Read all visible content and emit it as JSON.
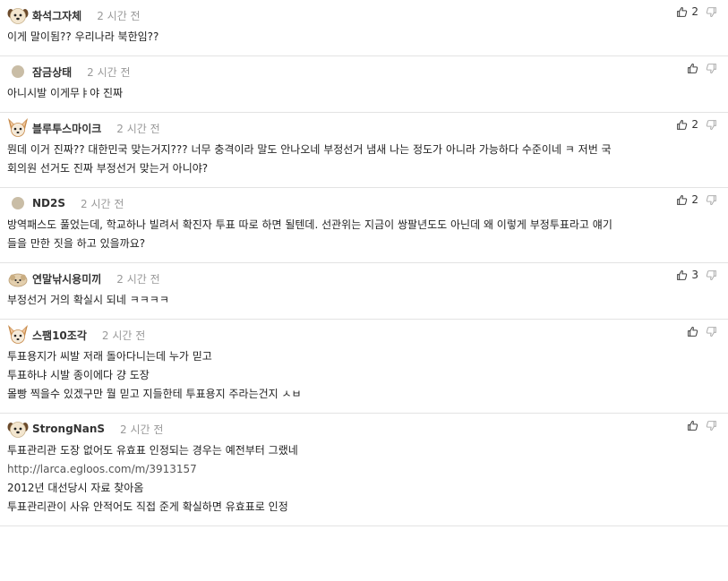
{
  "comments": [
    {
      "nick": "화석그자체",
      "time": "2 시간 전",
      "avatar": "dog-face",
      "likes": "2",
      "lines": [
        "이게 말이됨?? 우리나라 북한임??"
      ]
    },
    {
      "nick": "잠금상태",
      "time": "2 시간 전",
      "avatar": "dot",
      "likes": "",
      "lines": [
        "아니시발 이게무ㅑ야 진짜"
      ]
    },
    {
      "nick": "블루투스마이크",
      "time": "2 시간 전",
      "avatar": "chihuahua",
      "likes": "2",
      "lines": [
        "뭔데 이거 진짜?? 대한민국 맞는거지??? 너무 충격이라 말도 안나오네 부정선거 냄새 나는 정도가 아니라 가능하다 수준이네 ㅋ 저번 국",
        "회의원 선거도 진짜 부정선거 맞는거 아니야?"
      ]
    },
    {
      "nick": "ND2S",
      "time": "2 시간 전",
      "avatar": "dot",
      "likes": "2",
      "lines": [
        "방역패스도 풀었는데, 학교하나 빌려서 확진자 투표 따로 하면 될텐데. 선관위는 지금이 쌍팔년도도 아닌데 왜 이렇게 부정투표라고 얘기",
        "들을 만한 짓을 하고 있을까요?"
      ]
    },
    {
      "nick": "연말낚시용미끼",
      "time": "2 시간 전",
      "avatar": "bun",
      "likes": "3",
      "lines": [
        "부정선거 거의 확실시 되네 ㅋㅋㅋㅋ"
      ]
    },
    {
      "nick": "스팸10조각",
      "time": "2 시간 전",
      "avatar": "chihuahua",
      "likes": "",
      "lines": [
        "투표용지가 씨발 저래 돌아다니는데 누가 믿고",
        "투표하냐 시발 종이에다 걍 도장",
        "몰빵 찍을수 있겠구만 뭘 믿고 지들한테 투표용지 주라는건지 ㅅㅂ"
      ]
    },
    {
      "nick": "StrongNanS",
      "time": "2 시간 전",
      "avatar": "dog-face",
      "likes": "",
      "lines": [
        "투표관리관 도장 없어도 유효표 인정되는 경우는 예전부터 그랬네",
        "http://larca.egloos.com/m/3913157",
        "2012년 대선당시 자료 찾아옴",
        "투표관리관이 사유 안적어도 직접 준게 확실하면 유효표로 인정"
      ]
    }
  ]
}
